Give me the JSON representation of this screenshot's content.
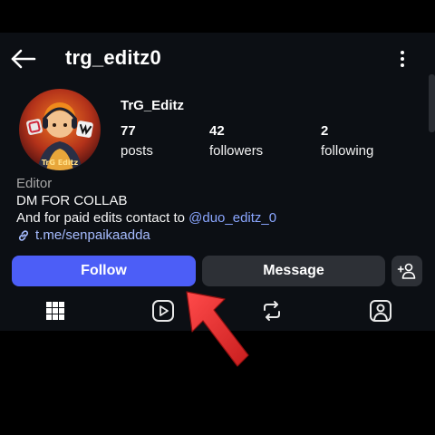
{
  "header": {
    "username": "trg_editz0",
    "back_icon": "arrow-left-icon",
    "more_icon": "more-vertical-icon"
  },
  "profile": {
    "display_name": "TrG_Editz",
    "avatar_caption": "TrG Editz",
    "stats": {
      "posts": {
        "value": "77",
        "label": "posts"
      },
      "followers": {
        "value": "42",
        "label": "followers"
      },
      "following": {
        "value": "2",
        "label": "following"
      }
    }
  },
  "bio": {
    "category": "Editor",
    "line1": "DM FOR COLLAB",
    "line2_text": "And for paid edits contact to ",
    "line2_mention": "@duo_editz_0",
    "link": "t.me/senpaikaadda"
  },
  "actions": {
    "follow_label": "Follow",
    "message_label": "Message"
  },
  "tabs": [
    "grid-icon",
    "reels-icon",
    "reposts-icon",
    "tagged-icon"
  ],
  "colors": {
    "follow": "#4c5ef7",
    "secondary_button": "#2d3036",
    "background": "#0c0f14",
    "mention": "#8aa6ff",
    "annotation_arrow": "#e32b2b"
  }
}
